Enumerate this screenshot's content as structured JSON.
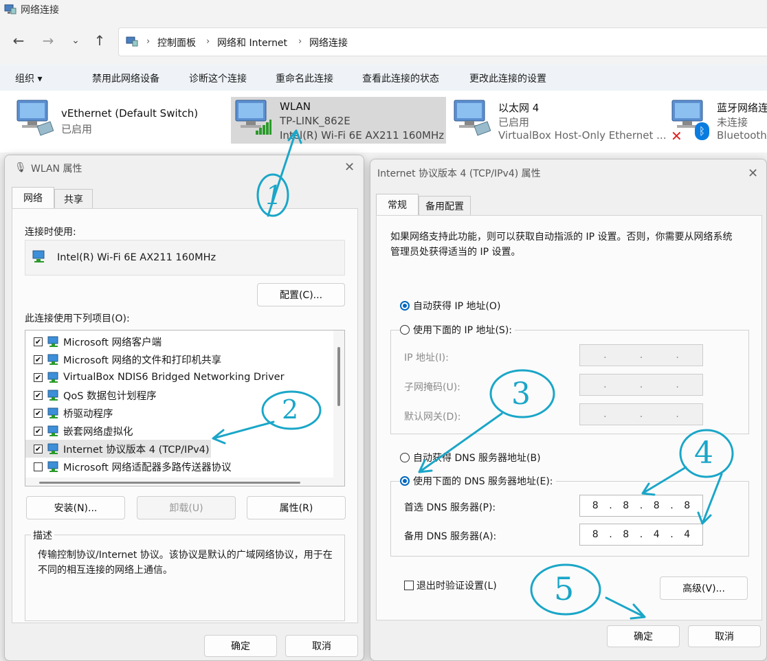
{
  "window": {
    "title": "网络连接"
  },
  "breadcrumb": {
    "items": [
      "控制面板",
      "网络和 Internet",
      "网络连接"
    ]
  },
  "commands": [
    "组织 ▾",
    "禁用此网络设备",
    "诊断这个连接",
    "重命名此连接",
    "查看此连接的状态",
    "更改此连接的设置"
  ],
  "connections": [
    {
      "name": "vEthernet (Default Switch)",
      "status": "已启用",
      "device": ""
    },
    {
      "name": "WLAN",
      "status": "TP-LINK_862E",
      "device": "Intel(R) Wi-Fi 6E AX211 160MHz"
    },
    {
      "name": "以太网 4",
      "status": "已启用",
      "device": "VirtualBox Host-Only Ethernet ..."
    },
    {
      "name": "蓝牙网络连",
      "status": "未连接",
      "device": "Bluetooth"
    }
  ],
  "wlan_dialog": {
    "title": "WLAN 属性",
    "tabs": [
      "网络",
      "共享"
    ],
    "connect_using_label": "连接时使用:",
    "adapter": "Intel(R) Wi-Fi 6E AX211 160MHz",
    "configure_button": "配置(C)...",
    "items_label": "此连接使用下列项目(O):",
    "items": [
      {
        "label": "Microsoft 网络客户端",
        "checked": true
      },
      {
        "label": "Microsoft 网络的文件和打印机共享",
        "checked": true
      },
      {
        "label": "VirtualBox NDIS6 Bridged Networking Driver",
        "checked": true
      },
      {
        "label": "QoS 数据包计划程序",
        "checked": true
      },
      {
        "label": "桥驱动程序",
        "checked": true
      },
      {
        "label": "嵌套网络虚拟化",
        "checked": true
      },
      {
        "label": "Internet 协议版本 4 (TCP/IPv4)",
        "checked": true
      },
      {
        "label": "Microsoft 网络适配器多路传送器协议",
        "checked": false
      }
    ],
    "install_button": "安装(N)...",
    "uninstall_button": "卸载(U)",
    "properties_button": "属性(R)",
    "description_label": "描述",
    "description_text": "传输控制协议/Internet 协议。该协议是默认的广域网络协议，用于在不同的相互连接的网络上通信。",
    "ok_button": "确定",
    "cancel_button": "取消"
  },
  "ipv4_dialog": {
    "title": "Internet 协议版本 4 (TCP/IPv4) 属性",
    "tabs": [
      "常规",
      "备用配置"
    ],
    "intro": "如果网络支持此功能，则可以获取自动指派的 IP 设置。否则，你需要从网络系统管理员处获得适当的 IP 设置。",
    "auto_ip": "自动获得 IP 地址(O)",
    "manual_ip": "使用下面的 IP 地址(S):",
    "ip_address_label": "IP 地址(I):",
    "subnet_label": "子网掩码(U):",
    "gateway_label": "默认网关(D):",
    "auto_dns": "自动获得 DNS 服务器地址(B)",
    "manual_dns": "使用下面的 DNS 服务器地址(E):",
    "preferred_dns_label": "首选 DNS 服务器(P):",
    "preferred_dns": [
      "8",
      "8",
      "8",
      "8"
    ],
    "alternate_dns_label": "备用 DNS 服务器(A):",
    "alternate_dns": [
      "8",
      "8",
      "4",
      "4"
    ],
    "validate_label": "退出时验证设置(L)",
    "advanced_button": "高级(V)...",
    "ok_button": "确定",
    "cancel_button": "取消"
  },
  "annotations": [
    "1",
    "2",
    "3",
    "4",
    "5"
  ],
  "colors": {
    "accent": "#0067c0",
    "annotation": "#1aa6c8",
    "selected": "#d8d8d8"
  }
}
